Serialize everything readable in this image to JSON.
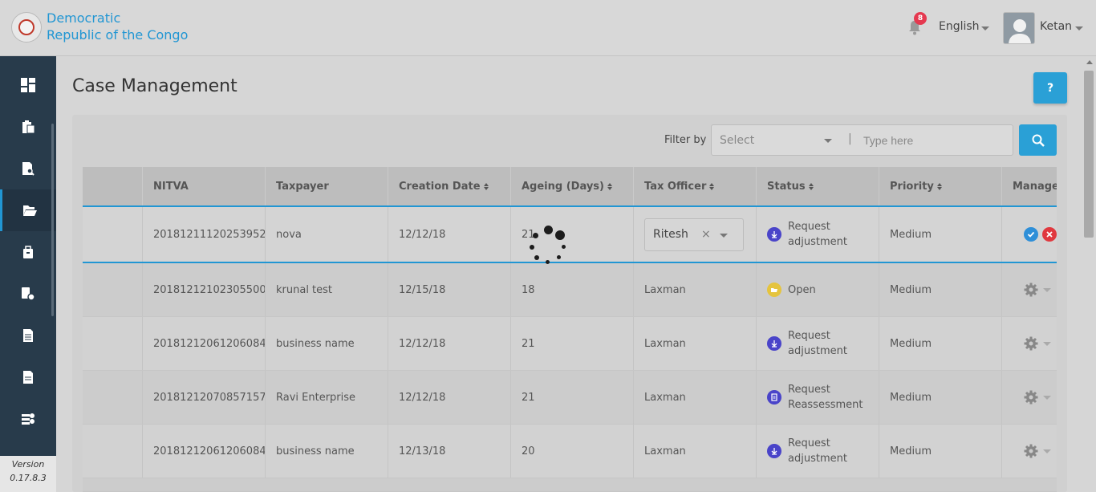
{
  "header": {
    "logo_line1": "Democratic",
    "logo_line2": "Republic of the Congo",
    "notification_count": "8",
    "language": "English",
    "user_name": "Ketan"
  },
  "sidebar": {
    "items": [
      {
        "icon": "dashboard-icon"
      },
      {
        "icon": "clipboard-icon"
      },
      {
        "icon": "document-search-icon"
      },
      {
        "icon": "folder-open-icon",
        "active": true
      },
      {
        "icon": "briefcase-icon"
      },
      {
        "icon": "user-settings-icon"
      },
      {
        "icon": "report-icon"
      },
      {
        "icon": "document-icon"
      },
      {
        "icon": "database-user-icon"
      }
    ],
    "version_label": "Version",
    "version_number": "0.17.8.3"
  },
  "page": {
    "title": "Case Management",
    "help_label": "?"
  },
  "filter": {
    "label": "Filter by",
    "select_placeholder": "Select",
    "separator": "|",
    "input_placeholder": "Type here"
  },
  "table": {
    "columns": [
      "NITVA",
      "Taxpayer",
      "Creation Date",
      "Ageing (Days)",
      "Tax Officer",
      "Status",
      "Priority",
      "Manage"
    ],
    "rows": [
      {
        "nitva": "20181211120253952",
        "taxpayer": "nova",
        "date": "12/12/18",
        "ageing": "21",
        "officer": "Ritesh",
        "status": "Request adjustment",
        "status_icon": "request-adjustment-icon",
        "priority": "Medium"
      },
      {
        "nitva": "20181212102305500",
        "taxpayer": "krunal test",
        "date": "12/15/18",
        "ageing": "18",
        "officer": "Laxman",
        "status": "Open",
        "status_icon": "open-folder-icon",
        "priority": "Medium"
      },
      {
        "nitva": "20181212061206084",
        "taxpayer": "business name",
        "date": "12/12/18",
        "ageing": "21",
        "officer": "Laxman",
        "status": "Request adjustment",
        "status_icon": "request-adjustment-icon",
        "priority": "Medium"
      },
      {
        "nitva": "20181212070857157",
        "taxpayer": "Ravi Enterprise",
        "date": "12/12/18",
        "ageing": "21",
        "officer": "Laxman",
        "status": "Request Reassessment",
        "status_icon": "request-reassessment-icon",
        "priority": "Medium"
      },
      {
        "nitva": "20181212061206084",
        "taxpayer": "business name",
        "date": "12/13/18",
        "ageing": "20",
        "officer": "Laxman",
        "status": "Request adjustment",
        "status_icon": "request-adjustment-icon",
        "priority": "Medium"
      }
    ]
  },
  "colors": {
    "accent": "#2aa0d6",
    "sidebar": "#283b4b",
    "badge": "#e53950",
    "status_blue": "#4a44c9",
    "status_yellow": "#e5c43e"
  }
}
